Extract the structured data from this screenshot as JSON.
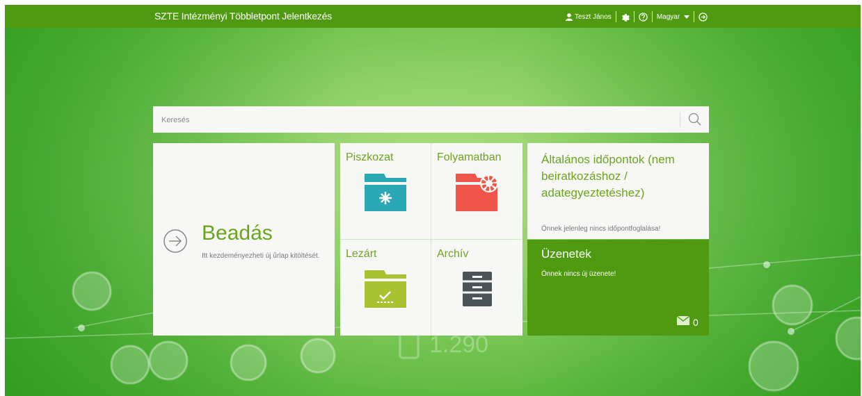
{
  "header": {
    "app_title": "SZTE Intézményi Többletpont Jelentkezés",
    "user_name": "Teszt János",
    "language": "Magyar"
  },
  "search": {
    "placeholder": "Keresés"
  },
  "tiles": {
    "submit": {
      "title": "Beadás",
      "description": "Itt kezdeményezheti új űrlap kitöltését."
    },
    "draft": {
      "label": "Piszkozat"
    },
    "in_progress": {
      "label": "Folyamatban"
    },
    "closed": {
      "label": "Lezárt"
    },
    "archive": {
      "label": "Archív"
    },
    "appointments": {
      "title": "Általános időpontok (nem beiratkozáshoz / adategyeztetéshez)",
      "note": "Önnek jelenleg nincs időpontfoglalása!"
    },
    "messages": {
      "title": "Üzenetek",
      "note": "Önnek nincs új üzenete!",
      "count": "0"
    }
  },
  "background": {
    "watermark_number": "1.290"
  },
  "colors": {
    "topbar": "#4f9a10",
    "accent_text": "#6aa51d",
    "draft_teal": "#2aa8b6",
    "progress_red": "#f0554a",
    "closed_olive": "#a9c232",
    "archive_gray": "#4a5358"
  }
}
